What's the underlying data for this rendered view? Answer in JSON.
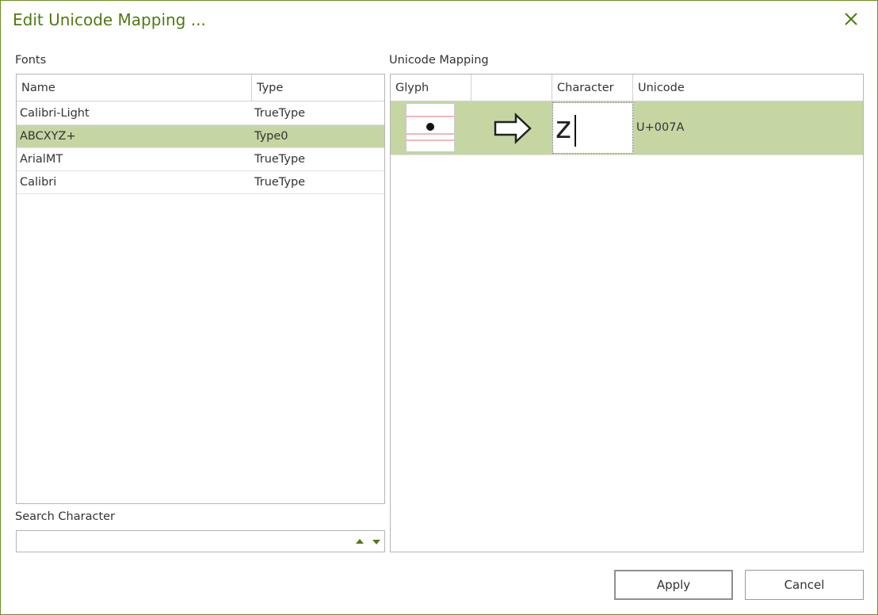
{
  "window": {
    "title": "Edit Unicode Mapping ..."
  },
  "fonts": {
    "label": "Fonts",
    "columns": {
      "name": "Name",
      "type": "Type"
    },
    "rows": [
      {
        "name": "Calibri-Light",
        "type": "TrueType",
        "selected": false
      },
      {
        "name": "ABCXYZ+",
        "type": "Type0",
        "selected": true
      },
      {
        "name": "ArialMT",
        "type": "TrueType",
        "selected": false
      },
      {
        "name": "Calibri",
        "type": "TrueType",
        "selected": false
      }
    ]
  },
  "search": {
    "label": "Search Character",
    "value": ""
  },
  "mapping": {
    "label": "Unicode Mapping",
    "columns": {
      "glyph": "Glyph",
      "arrow": "",
      "character": "Character",
      "unicode": "Unicode"
    },
    "rows": [
      {
        "glyph_icon": "dot-glyph-preview",
        "arrow_icon": "right-arrow-icon",
        "character": "z",
        "unicode": "U+007A"
      }
    ]
  },
  "buttons": {
    "apply": "Apply",
    "cancel": "Cancel"
  },
  "colors": {
    "accent": "#4f7a12",
    "selection": "#c5d6a3",
    "border": "#6b8e23"
  }
}
